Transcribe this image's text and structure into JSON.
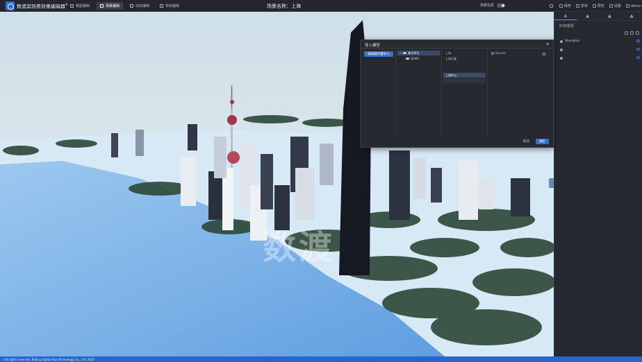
{
  "header": {
    "app_title": "数渡梁场景效果编辑器",
    "app_title_sup": "®",
    "mode_tabs": [
      {
        "label": "模型编辑",
        "active": false
      },
      {
        "label": "场景编辑",
        "active": true
      },
      {
        "label": "动态编辑",
        "active": false
      },
      {
        "label": "特效编辑",
        "active": false
      }
    ],
    "scene_label": "场景名称：上海",
    "scene_info_label": "场景信息",
    "actions": [
      {
        "label": "",
        "icon": "open-icon"
      },
      {
        "label": "保存",
        "icon": "save-icon"
      },
      {
        "label": "发布",
        "icon": "publish-icon"
      },
      {
        "label": "预览",
        "icon": "preview-icon"
      },
      {
        "label": "设置",
        "icon": "settings-icon"
      },
      {
        "label": "demo",
        "icon": "user-icon"
      }
    ]
  },
  "right_panel": {
    "tabs": [
      "layers-icon",
      "location-icon",
      "tools-icon",
      "image-icon"
    ],
    "title": "3D数据源",
    "tree": [
      {
        "label": "Shanghai",
        "visible": true
      },
      {
        "label": "",
        "visible": true
      },
      {
        "label": "",
        "visible": true
      }
    ]
  },
  "dialog": {
    "title": "导入模型",
    "source_button": "编辑器内置导入",
    "column1": [
      {
        "label": "数字孪生",
        "selected": true
      },
      {
        "label": "DEMO",
        "selected": false
      }
    ],
    "column2": [
      {
        "label": "上海",
        "selected": false
      },
      {
        "label": "上海大厦",
        "selected": false
      },
      {
        "label": "",
        "selected": false
      },
      {
        "label": "",
        "selected": false
      },
      {
        "label": "上海中心",
        "selected": true
      },
      {
        "label": "",
        "selected": false
      }
    ],
    "column3": [
      {
        "label": "Ground"
      }
    ],
    "cancel_label": "取消",
    "ok_label": "确定"
  },
  "viewport": {
    "watermark": "数渡"
  },
  "status": {
    "left": "| All rights reserved, Beijing Digital Hud Technology Co., Ltd. 2023",
    "right": ""
  },
  "colors": {
    "accent": "#2f6fd6",
    "water": "#7eb3e8",
    "land": "#cfe4f3",
    "trees": "#2f4a3c"
  }
}
